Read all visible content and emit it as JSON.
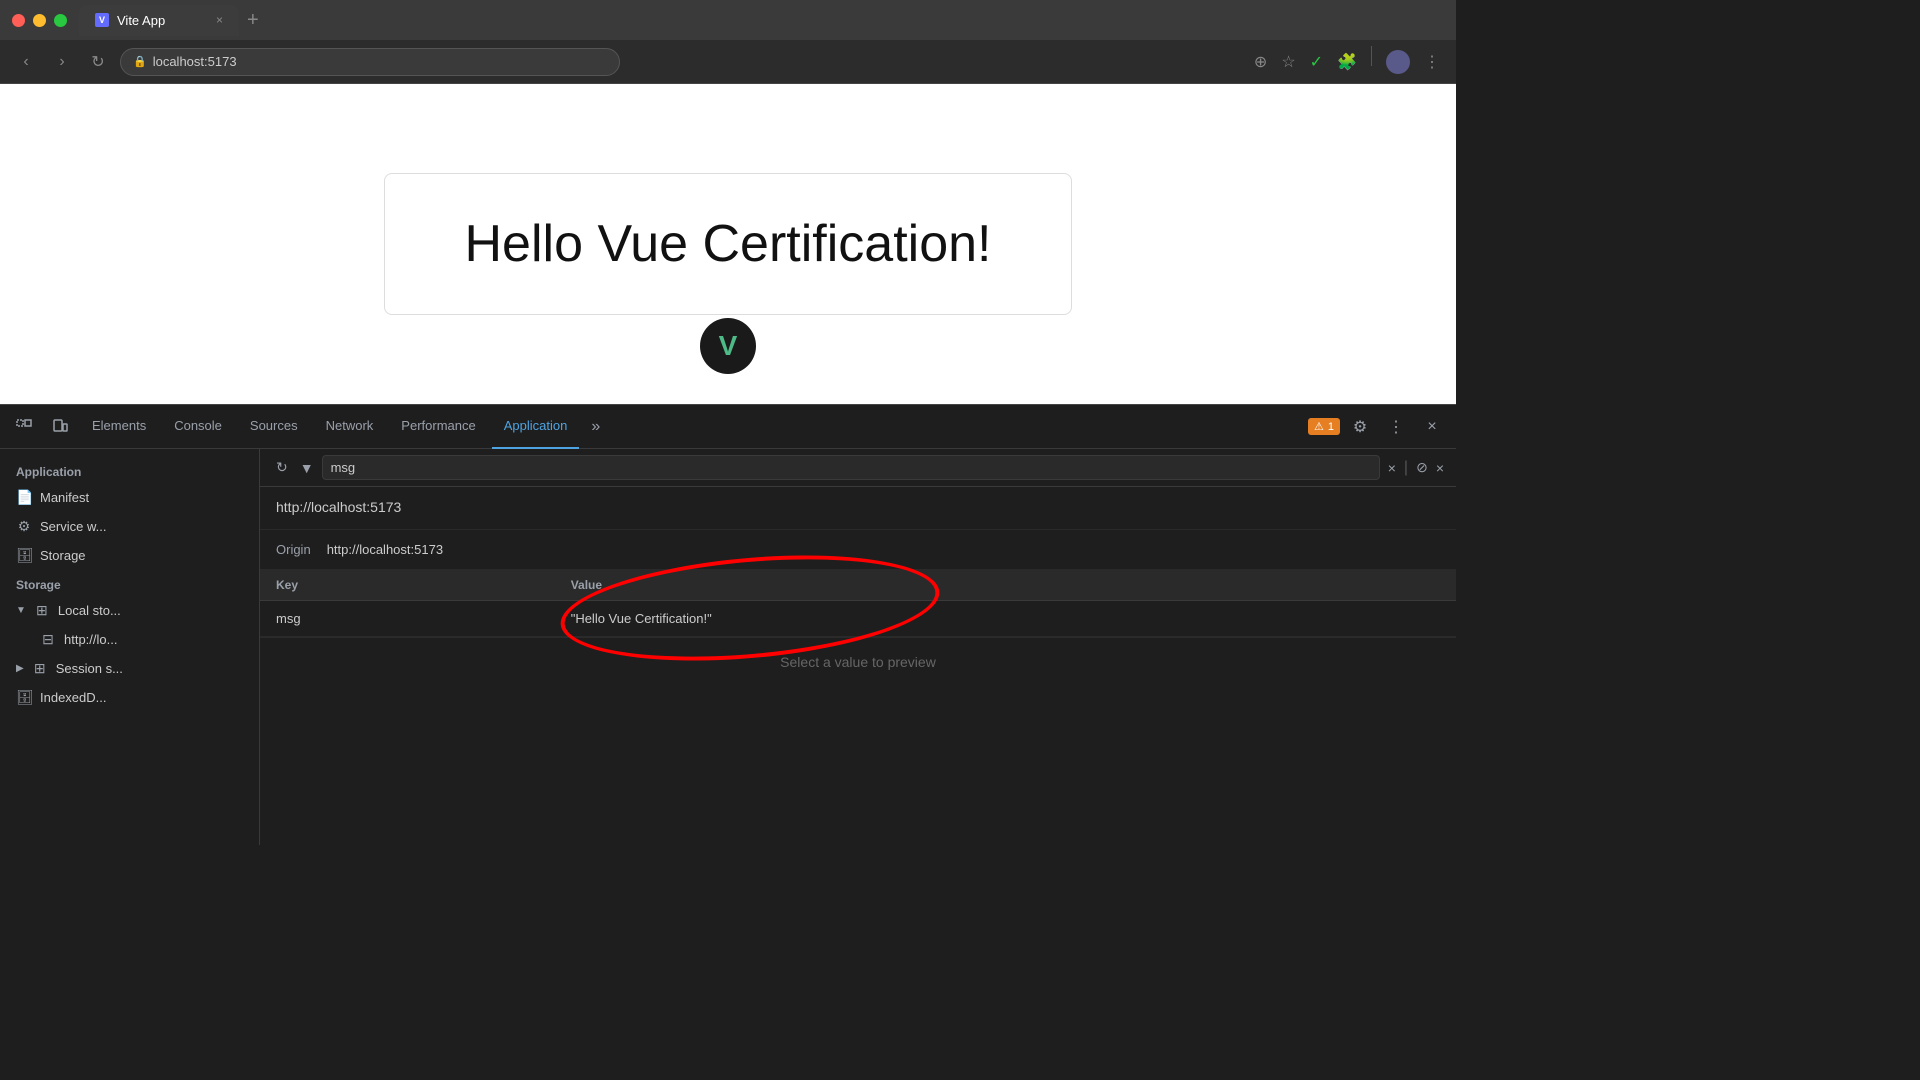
{
  "browser": {
    "title": "Vite App",
    "url": "localhost:5173",
    "tab_close": "×",
    "tab_new": "+",
    "tab_more": ""
  },
  "nav": {
    "back": "‹",
    "forward": "›",
    "reload": "↻",
    "zoom": "⊕",
    "star": "☆",
    "extension1": "✓",
    "shield": "🛡",
    "avatar": "👤",
    "more": "⋮"
  },
  "main": {
    "heading": "Hello Vue Certification!",
    "vue_logo": "V"
  },
  "devtools": {
    "tabs": [
      {
        "label": "Elements",
        "active": false
      },
      {
        "label": "Console",
        "active": false
      },
      {
        "label": "Sources",
        "active": false
      },
      {
        "label": "Network",
        "active": false
      },
      {
        "label": "Performance",
        "active": false
      },
      {
        "label": "Application",
        "active": true
      }
    ],
    "more_tabs": "»",
    "warning_count": "1",
    "settings_icon": "⚙",
    "more_icon": "⋮",
    "close_icon": "×",
    "inspect_icon": "⊡",
    "device_icon": "□",
    "sidebar": {
      "app_section": "Application",
      "manifest_label": "Manifest",
      "service_worker_label": "Service w...",
      "storage_label": "Storage",
      "storage_section": "Storage",
      "local_storage_label": "Local sto...",
      "local_storage_url": "http://lo...",
      "session_storage_label": "Session s...",
      "indexed_db_label": "IndexedD..."
    },
    "filter": {
      "placeholder": "msg",
      "reload_icon": "↻",
      "filter_icon": "▼",
      "clear_icon": "×",
      "separator": "|",
      "block_icon": "⊘",
      "close_icon": "×"
    },
    "storage": {
      "url": "http://localhost:5173",
      "origin_label": "Origin",
      "origin_value": "http://localhost:5173",
      "key_header": "Key",
      "value_header": "Value",
      "rows": [
        {
          "key": "msg",
          "value": "\"Hello Vue Certification!\""
        }
      ]
    },
    "select_preview": "Select a value to preview"
  }
}
